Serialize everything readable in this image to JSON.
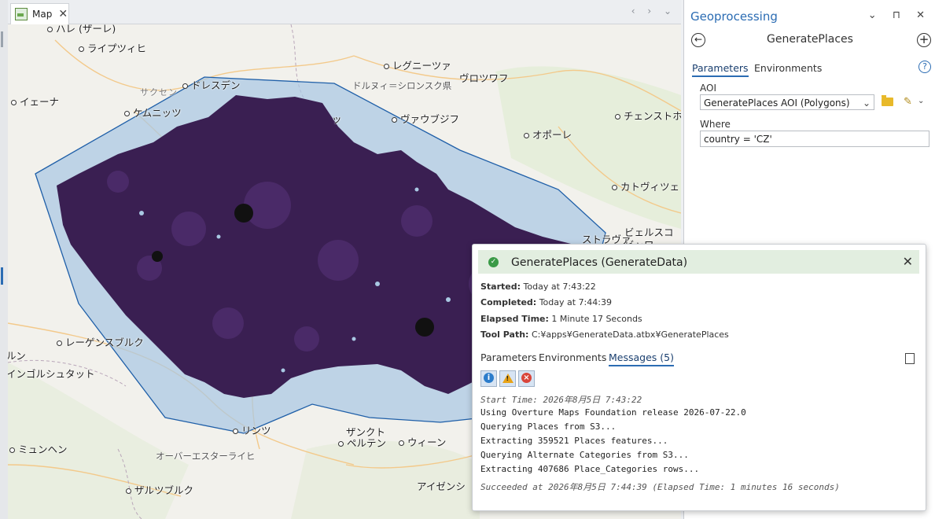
{
  "map": {
    "tab_label": "Map",
    "tab_close": "✕",
    "nav_arrows": "‹ › ⌄",
    "labels": [
      {
        "text": "ハレ (ザーレ)",
        "dot": true
      },
      {
        "text": "ライプツィヒ",
        "dot": true
      },
      {
        "text": "レグニーツァ",
        "dot": true
      },
      {
        "text": "ヴロツワフ",
        "dot": false
      },
      {
        "text": "サクセン",
        "dot": false
      },
      {
        "text": "ドレスデン",
        "dot": true
      },
      {
        "text": "ドルヌィ＝シロンスク県",
        "dot": false
      },
      {
        "text": "イェーナ",
        "dot": true
      },
      {
        "text": "ケムニッツ",
        "dot": true
      },
      {
        "text": "ヴァウブジフ",
        "dot": true
      },
      {
        "text": "チェンストホ",
        "dot": true
      },
      {
        "text": "オポーレ",
        "dot": true
      },
      {
        "text": "カトヴィツェ",
        "dot": true
      },
      {
        "text": "ビェルスコ",
        "dot": false
      },
      {
        "text": "ビャワ",
        "dot": false
      },
      {
        "text": "ストラヴァ",
        "dot": false
      },
      {
        "text": "レーゲンスブルク",
        "dot": true
      },
      {
        "text": "ルン",
        "dot": false
      },
      {
        "text": "インゴルシュタット",
        "dot": false
      },
      {
        "text": "リンツ",
        "dot": true
      },
      {
        "text": "ザンクト",
        "dot": false
      },
      {
        "text": "ペルテン",
        "dot": true
      },
      {
        "text": "ウィーン",
        "dot": true
      },
      {
        "text": "ミュンヘン",
        "dot": true
      },
      {
        "text": "オーバーエスターライヒ",
        "dot": false
      },
      {
        "text": "ザルツブルク",
        "dot": true
      },
      {
        "text": "アイゼンシ",
        "dot": false
      },
      {
        "text": "ッ",
        "dot": false
      }
    ],
    "colors": {
      "aoi_fill": "#a9c8e3",
      "aoi_stroke": "#1f5fa8",
      "points": "#3a1f52"
    }
  },
  "gp": {
    "title": "Geoprocessing",
    "controls": "⌄ ⊓ ✕",
    "tool_name": "GeneratePlaces",
    "back": "←",
    "add": "+",
    "tabs": [
      "Parameters",
      "Environments"
    ],
    "help": "?",
    "aoi_label": "AOI",
    "aoi_value": "GeneratePlaces AOI (Polygons)",
    "where_label": "Where",
    "where_value": "country = 'CZ'"
  },
  "popup": {
    "title": "GeneratePlaces (GenerateData)",
    "close": "✕",
    "started_label": "Started:",
    "started_value": "Today at 7:43:22",
    "completed_label": "Completed:",
    "completed_value": "Today at 7:44:39",
    "elapsed_label": "Elapsed Time:",
    "elapsed_value": "1 Minute 17 Seconds",
    "toolpath_label": "Tool Path:",
    "toolpath_value": "C:¥apps¥GenerateData.atbx¥GeneratePlaces",
    "tabs": [
      "Parameters",
      "Environments",
      "Messages (5)"
    ],
    "filter_icons": {
      "info": "i",
      "warn": "!",
      "error": "×"
    },
    "messages": [
      "Start Time: 2026年8月5日 7:43:22",
      "Using Overture Maps Foundation release 2026-07-22.0",
      "Querying Places from S3...",
      "Extracting 359521 Places features...",
      "Querying Alternate Categories from S3...",
      "Extracting 407686 Place_Categories rows...",
      "Succeeded at 2026年8月5日 7:44:39 (Elapsed Time: 1 minutes 16 seconds)"
    ]
  }
}
